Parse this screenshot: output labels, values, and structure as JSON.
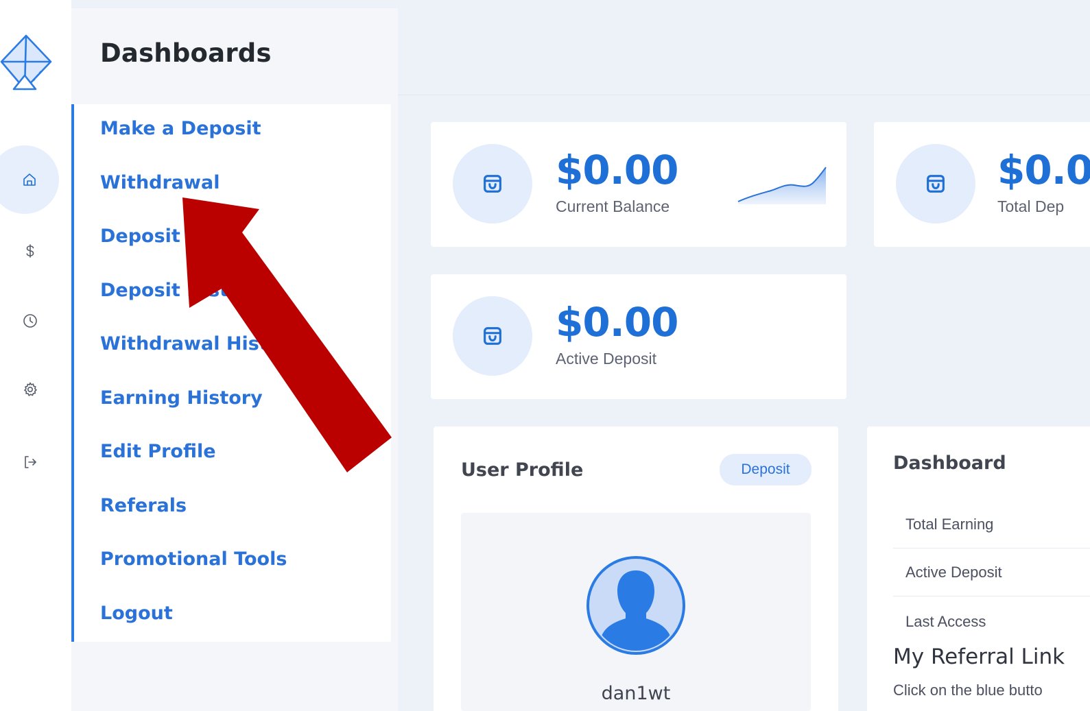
{
  "colors": {
    "accent": "#1e6fd6",
    "menu_link": "#2a72d8",
    "background": "#edf1f8",
    "annotation_arrow": "#bb0000"
  },
  "rail": {
    "icons": [
      "home-icon",
      "dollar-icon",
      "clock-icon",
      "gear-icon",
      "logout-icon"
    ],
    "active": "home-icon"
  },
  "menu": {
    "title": "Dashboards",
    "items": [
      {
        "label": "Make a Deposit"
      },
      {
        "label": "Withdrawal"
      },
      {
        "label": "Deposit L"
      },
      {
        "label": "Deposit Histo"
      },
      {
        "label": "Withdrawal Histo"
      },
      {
        "label": "Earning History"
      },
      {
        "label": "Edit Profile"
      },
      {
        "label": "Referals"
      },
      {
        "label": "Promotional Tools"
      },
      {
        "label": "Logout"
      }
    ]
  },
  "stats": {
    "current_balance": {
      "value": "$0.00",
      "label": "Current Balance",
      "icon": "bag-icon"
    },
    "total_deposit": {
      "value": "$0.0",
      "label": "Total Dep",
      "icon": "bag-icon"
    },
    "active_deposit": {
      "value": "$0.00",
      "label": "Active Deposit",
      "icon": "bag-icon"
    }
  },
  "user_profile": {
    "title": "User Profile",
    "deposit_button": "Deposit",
    "username": "dan1wt",
    "avatar_icon": "user-avatar-icon"
  },
  "dashboard": {
    "title": "Dashboard",
    "rows": [
      {
        "label": "Total Earning"
      },
      {
        "label": "Active Deposit"
      },
      {
        "label": "Last Access"
      }
    ],
    "referral_title": "My Referral Link",
    "referral_desc": "Click on the blue butto"
  }
}
